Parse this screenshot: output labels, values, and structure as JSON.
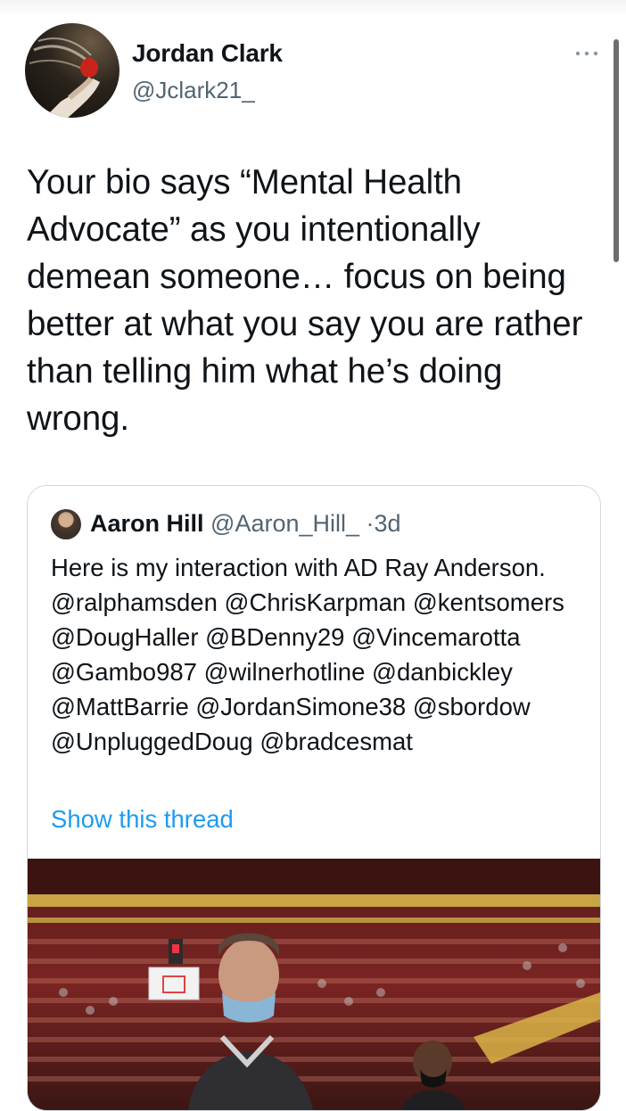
{
  "author": {
    "name": "Jordan Clark",
    "handle": "@Jclark21_",
    "avatar_icon": "avatar-painting-icon"
  },
  "more_icon": "ellipsis-icon",
  "tweet": {
    "text": "Your bio says “Mental Health Advocate” as you intentionally demean someone… focus on being better at what you say you are rather than telling him what he’s doing wrong."
  },
  "quoted": {
    "name": "Aaron Hill",
    "handle": "@Aaron_Hill_",
    "separator": "·",
    "time": "3d",
    "text": "Here is my interaction with AD Ray Anderson. @ralphamsden @ChrisKarpman @kentsomers @DougHaller @BDenny29 @Vincemarotta @Gambo987 @wilnerhotline @danbickley @MattBarrie @JordanSimone38 @sbordow @UnpluggedDoug @bradcesmat",
    "show_thread": "Show this thread",
    "media_icon": "arena-video-thumbnail"
  },
  "colors": {
    "link": "#1d9bf0",
    "secondary_text": "#536471",
    "border": "#cfd9de"
  }
}
